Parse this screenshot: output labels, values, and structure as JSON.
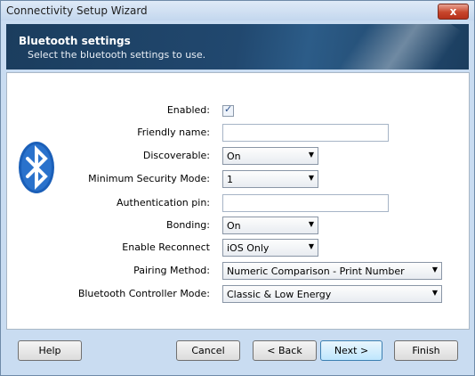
{
  "window": {
    "title": "Connectivity Setup Wizard",
    "close_label": "x"
  },
  "header": {
    "title": "Bluetooth settings",
    "subtitle": "Select the bluetooth settings to use."
  },
  "form": {
    "enabled": {
      "label": "Enabled:",
      "checked": true,
      "check_glyph": "✓"
    },
    "friendly_name": {
      "label": "Friendly name:",
      "value": ""
    },
    "discoverable": {
      "label": "Discoverable:",
      "value": "On"
    },
    "min_security": {
      "label": "Minimum Security Mode:",
      "value": "1"
    },
    "auth_pin": {
      "label": "Authentication pin:",
      "value": ""
    },
    "bonding": {
      "label": "Bonding:",
      "value": "On"
    },
    "reconnect": {
      "label": "Enable Reconnect",
      "value": "iOS Only"
    },
    "pairing": {
      "label": "Pairing Method:",
      "value": "Numeric Comparison - Print Number"
    },
    "controller_mode": {
      "label": "Bluetooth Controller Mode:",
      "value": "Classic & Low Energy"
    }
  },
  "footer": {
    "help": "Help",
    "cancel": "Cancel",
    "back": "< Back",
    "next": "Next >",
    "finish": "Finish"
  },
  "icons": {
    "logo": "bluetooth-icon",
    "dropdown": "chevron-down-icon"
  },
  "colors": {
    "banner": "#1b3d5e",
    "logo": "#1b5fb8",
    "close": "#c7452b"
  }
}
